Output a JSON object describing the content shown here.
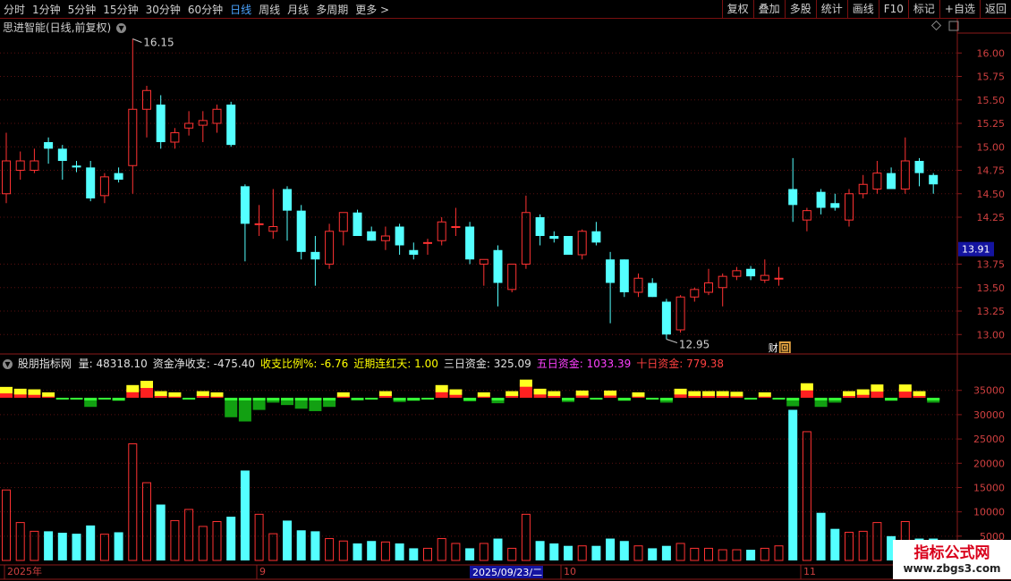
{
  "toolbar": {
    "periods": [
      "分时",
      "1分钟",
      "5分钟",
      "15分钟",
      "30分钟",
      "60分钟",
      "日线",
      "周线",
      "月线",
      "多周期",
      "更多 >"
    ],
    "active_period": "日线",
    "right_buttons": [
      "复权",
      "叠加",
      "多股",
      "统计",
      "画线",
      "F10",
      "标记",
      "+自选",
      "返回"
    ]
  },
  "main_pane": {
    "title": "思进智能(日线,前复权)",
    "high_label": "16.15",
    "low_label": "12.95",
    "price_axis_ticks": [
      "16.00",
      "15.75",
      "15.50",
      "15.25",
      "15.00",
      "14.75",
      "14.50",
      "14.25",
      "13.75",
      "13.50",
      "13.25",
      "13.00"
    ],
    "current_price_tag": "13.91",
    "event_marker": "财",
    "event_marker2": "回"
  },
  "indicator_pane": {
    "name": "股朋指标网",
    "items": [
      {
        "label": "量: 48318.10",
        "color": "#e0e0e0"
      },
      {
        "label": "资金净收支: -475.40",
        "color": "#e0e0e0"
      },
      {
        "label": "收支比例%: -6.76",
        "color": "#ffff00"
      },
      {
        "label": "近期连红天: 1.00",
        "color": "#ffff00"
      },
      {
        "label": "三日资金: 325.09",
        "color": "#e0e0e0"
      },
      {
        "label": "五日资金: 1033.39",
        "color": "#ff40ff"
      },
      {
        "label": "十日资金: 779.38",
        "color": "#ff4040"
      }
    ],
    "volume_axis_ticks": [
      "35000",
      "30000",
      "25000",
      "20000",
      "15000",
      "10000",
      "5000"
    ]
  },
  "date_axis": {
    "labels": [
      "2025年",
      "9",
      "10",
      "11"
    ],
    "cursor_date": "2025/09/23/二"
  },
  "watermark": {
    "title": "指标公式网",
    "url": "www.zbgs3.com"
  },
  "chart_data": {
    "type": "candlestick",
    "title": "思进智能(日线,前复权)",
    "price_range": [
      12.85,
      16.25
    ],
    "volume_range": [
      0,
      39000
    ],
    "candles": [
      {
        "o": 14.5,
        "h": 15.15,
        "l": 14.4,
        "c": 14.85,
        "v": 14500,
        "f": 1200
      },
      {
        "o": 14.75,
        "h": 14.95,
        "l": 14.65,
        "c": 14.85,
        "v": 7800,
        "f": 900
      },
      {
        "o": 14.75,
        "h": 14.98,
        "l": 14.72,
        "c": 14.85,
        "v": 6000,
        "f": 800
      },
      {
        "o": 15.05,
        "h": 15.1,
        "l": 14.82,
        "c": 14.98,
        "v": 6000,
        "f": 300
      },
      {
        "o": 14.98,
        "h": 15.02,
        "l": 14.65,
        "c": 14.85,
        "v": 5700,
        "f": -100
      },
      {
        "o": 14.8,
        "h": 14.85,
        "l": 14.73,
        "c": 14.78,
        "v": 5500,
        "f": -300
      },
      {
        "o": 14.78,
        "h": 14.85,
        "l": 14.42,
        "c": 14.45,
        "v": 7200,
        "f": -1500
      },
      {
        "o": 14.48,
        "h": 14.72,
        "l": 14.4,
        "c": 14.68,
        "v": 5400,
        "f": -200
      },
      {
        "o": 14.72,
        "h": 14.78,
        "l": 14.62,
        "c": 14.65,
        "v": 5800,
        "f": -500
      },
      {
        "o": 14.8,
        "h": 16.15,
        "l": 14.5,
        "c": 15.4,
        "v": 24000,
        "f": 1500
      },
      {
        "o": 15.4,
        "h": 15.65,
        "l": 15.1,
        "c": 15.6,
        "v": 16000,
        "f": 2200
      },
      {
        "o": 15.45,
        "h": 15.55,
        "l": 14.98,
        "c": 15.05,
        "v": 11500,
        "f": 500
      },
      {
        "o": 15.05,
        "h": 15.2,
        "l": 14.98,
        "c": 15.15,
        "v": 8200,
        "f": 300
      },
      {
        "o": 15.2,
        "h": 15.38,
        "l": 15.12,
        "c": 15.25,
        "v": 10500,
        "f": -200
      },
      {
        "o": 15.23,
        "h": 15.38,
        "l": 15.05,
        "c": 15.28,
        "v": 7000,
        "f": 500
      },
      {
        "o": 15.25,
        "h": 15.45,
        "l": 15.15,
        "c": 15.4,
        "v": 8000,
        "f": 200
      },
      {
        "o": 15.45,
        "h": 15.48,
        "l": 15.0,
        "c": 15.02,
        "v": 9000,
        "f": -3200
      },
      {
        "o": 14.58,
        "h": 14.6,
        "l": 13.78,
        "c": 14.18,
        "v": 18500,
        "f": -3900
      },
      {
        "o": 14.18,
        "h": 14.38,
        "l": 14.05,
        "c": 14.18,
        "v": 9500,
        "f": -2000
      },
      {
        "o": 14.1,
        "h": 14.55,
        "l": 14.02,
        "c": 14.15,
        "v": 5500,
        "f": -800
      },
      {
        "o": 14.55,
        "h": 14.58,
        "l": 14.0,
        "c": 14.32,
        "v": 8200,
        "f": -1200
      },
      {
        "o": 14.32,
        "h": 14.38,
        "l": 13.8,
        "c": 13.88,
        "v": 6200,
        "f": -1800
      },
      {
        "o": 13.88,
        "h": 14.05,
        "l": 13.52,
        "c": 13.8,
        "v": 6000,
        "f": -2200
      },
      {
        "o": 13.75,
        "h": 14.18,
        "l": 13.7,
        "c": 14.1,
        "v": 4500,
        "f": -1500
      },
      {
        "o": 14.1,
        "h": 14.3,
        "l": 13.95,
        "c": 14.3,
        "v": 4000,
        "f": 300
      },
      {
        "o": 14.3,
        "h": 14.33,
        "l": 14.05,
        "c": 14.05,
        "v": 3500,
        "f": -400
      },
      {
        "o": 14.1,
        "h": 14.15,
        "l": 14.0,
        "c": 14.0,
        "v": 4000,
        "f": -300
      },
      {
        "o": 14.0,
        "h": 14.15,
        "l": 13.9,
        "c": 14.05,
        "v": 3800,
        "f": 500
      },
      {
        "o": 14.15,
        "h": 14.18,
        "l": 13.85,
        "c": 13.95,
        "v": 3500,
        "f": -700
      },
      {
        "o": 13.9,
        "h": 13.98,
        "l": 13.8,
        "c": 13.85,
        "v": 2500,
        "f": -500
      },
      {
        "o": 13.98,
        "h": 14.02,
        "l": 13.85,
        "c": 13.98,
        "v": 2500,
        "f": -200
      },
      {
        "o": 14.0,
        "h": 14.25,
        "l": 13.95,
        "c": 14.2,
        "v": 4500,
        "f": 1500
      },
      {
        "o": 14.15,
        "h": 14.35,
        "l": 14.05,
        "c": 14.15,
        "v": 3500,
        "f": 800
      },
      {
        "o": 14.15,
        "h": 14.2,
        "l": 13.75,
        "c": 13.8,
        "v": 2500,
        "f": -600
      },
      {
        "o": 13.75,
        "h": 13.8,
        "l": 13.52,
        "c": 13.8,
        "v": 3500,
        "f": 300
      },
      {
        "o": 13.9,
        "h": 13.95,
        "l": 13.3,
        "c": 13.55,
        "v": 4500,
        "f": -900
      },
      {
        "o": 13.48,
        "h": 13.75,
        "l": 13.45,
        "c": 13.75,
        "v": 2500,
        "f": 500
      },
      {
        "o": 13.75,
        "h": 14.48,
        "l": 13.7,
        "c": 14.3,
        "v": 9500,
        "f": 2400
      },
      {
        "o": 14.25,
        "h": 14.28,
        "l": 13.95,
        "c": 14.05,
        "v": 4000,
        "f": 900
      },
      {
        "o": 14.05,
        "h": 14.1,
        "l": 13.98,
        "c": 14.02,
        "v": 3500,
        "f": 500
      },
      {
        "o": 14.05,
        "h": 14.05,
        "l": 13.85,
        "c": 13.85,
        "v": 3000,
        "f": -700
      },
      {
        "o": 13.85,
        "h": 14.12,
        "l": 13.8,
        "c": 14.1,
        "v": 3000,
        "f": 600
      },
      {
        "o": 14.1,
        "h": 14.2,
        "l": 13.95,
        "c": 13.98,
        "v": 3000,
        "f": -300
      },
      {
        "o": 13.8,
        "h": 13.88,
        "l": 13.12,
        "c": 13.55,
        "v": 4500,
        "f": 600
      },
      {
        "o": 13.8,
        "h": 13.8,
        "l": 13.4,
        "c": 13.45,
        "v": 4000,
        "f": -500
      },
      {
        "o": 13.45,
        "h": 13.65,
        "l": 13.4,
        "c": 13.6,
        "v": 3000,
        "f": 300
      },
      {
        "o": 13.55,
        "h": 13.6,
        "l": 13.4,
        "c": 13.4,
        "v": 2500,
        "f": -300
      },
      {
        "o": 13.35,
        "h": 13.38,
        "l": 12.95,
        "c": 13.0,
        "v": 3000,
        "f": -800
      },
      {
        "o": 13.05,
        "h": 13.42,
        "l": 13.02,
        "c": 13.4,
        "v": 3500,
        "f": 900
      },
      {
        "o": 13.4,
        "h": 13.5,
        "l": 13.35,
        "c": 13.48,
        "v": 2500,
        "f": 500
      },
      {
        "o": 13.45,
        "h": 13.7,
        "l": 13.42,
        "c": 13.55,
        "v": 2500,
        "f": 500
      },
      {
        "o": 13.5,
        "h": 13.65,
        "l": 13.3,
        "c": 13.62,
        "v": 2200,
        "f": 500
      },
      {
        "o": 13.62,
        "h": 13.72,
        "l": 13.58,
        "c": 13.68,
        "v": 2200,
        "f": 400
      },
      {
        "o": 13.7,
        "h": 13.73,
        "l": 13.58,
        "c": 13.62,
        "v": 2200,
        "f": -200
      },
      {
        "o": 13.58,
        "h": 13.8,
        "l": 13.55,
        "c": 13.63,
        "v": 2500,
        "f": 300
      },
      {
        "o": 13.6,
        "h": 13.72,
        "l": 13.52,
        "c": 13.6,
        "v": 3000,
        "f": -200
      },
      {
        "o": 14.55,
        "h": 14.88,
        "l": 14.2,
        "c": 14.38,
        "v": 31000,
        "f": -1400
      },
      {
        "o": 14.22,
        "h": 14.35,
        "l": 14.1,
        "c": 14.32,
        "v": 26500,
        "f": 1800
      },
      {
        "o": 14.52,
        "h": 14.55,
        "l": 14.28,
        "c": 14.35,
        "v": 9800,
        "f": -1500
      },
      {
        "o": 14.4,
        "h": 14.5,
        "l": 14.32,
        "c": 14.35,
        "v": 6500,
        "f": -800
      },
      {
        "o": 14.22,
        "h": 14.55,
        "l": 14.15,
        "c": 14.5,
        "v": 5800,
        "f": 500
      },
      {
        "o": 14.5,
        "h": 14.7,
        "l": 14.45,
        "c": 14.6,
        "v": 6000,
        "f": 800
      },
      {
        "o": 14.55,
        "h": 14.85,
        "l": 14.5,
        "c": 14.72,
        "v": 7800,
        "f": 1600
      },
      {
        "o": 14.72,
        "h": 14.78,
        "l": 14.55,
        "c": 14.55,
        "v": 5000,
        "f": -500
      },
      {
        "o": 14.55,
        "h": 15.1,
        "l": 14.5,
        "c": 14.85,
        "v": 8000,
        "f": 1600
      },
      {
        "o": 14.85,
        "h": 14.88,
        "l": 14.58,
        "c": 14.72,
        "v": 4500,
        "f": 500
      },
      {
        "o": 14.7,
        "h": 14.72,
        "l": 14.5,
        "c": 14.6,
        "v": 4500,
        "f": -800
      }
    ]
  }
}
